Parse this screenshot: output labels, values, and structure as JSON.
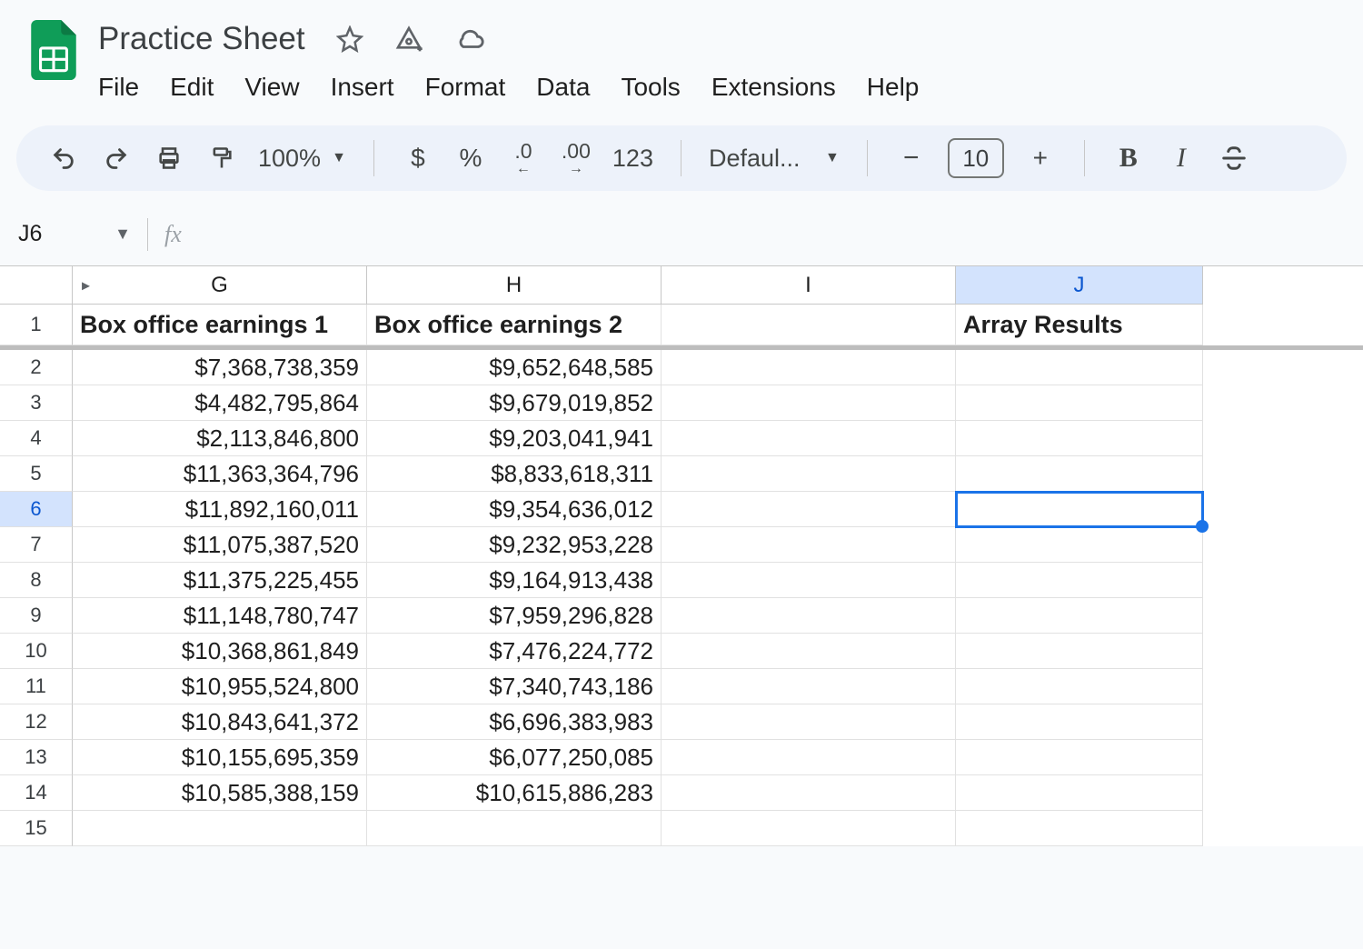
{
  "doc": {
    "title": "Practice Sheet"
  },
  "menu": {
    "file": "File",
    "edit": "Edit",
    "view": "View",
    "insert": "Insert",
    "format": "Format",
    "data": "Data",
    "tools": "Tools",
    "extensions": "Extensions",
    "help": "Help"
  },
  "toolbar": {
    "zoom": "100%",
    "currency": "$",
    "percent": "%",
    "decrease_decimal": ".0",
    "increase_decimal": ".00",
    "more_formats": "123",
    "font_name": "Defaul...",
    "font_size": "10",
    "minus": "−",
    "plus": "+",
    "bold": "B",
    "italic": "I"
  },
  "formula_bar": {
    "name_box": "J6",
    "fx_label": "fx"
  },
  "columns": {
    "G": "G",
    "H": "H",
    "I": "I",
    "J": "J"
  },
  "selected": {
    "row": 6,
    "col": "J"
  },
  "headers": {
    "G": "Box office earnings 1",
    "H": "Box office earnings 2",
    "I": "",
    "J": "Array Results"
  },
  "rows": [
    {
      "n": 2,
      "G": "$7,368,738,359",
      "H": "$9,652,648,585",
      "I": "",
      "J": ""
    },
    {
      "n": 3,
      "G": "$4,482,795,864",
      "H": "$9,679,019,852",
      "I": "",
      "J": ""
    },
    {
      "n": 4,
      "G": "$2,113,846,800",
      "H": "$9,203,041,941",
      "I": "",
      "J": ""
    },
    {
      "n": 5,
      "G": "$11,363,364,796",
      "H": "$8,833,618,311",
      "I": "",
      "J": ""
    },
    {
      "n": 6,
      "G": "$11,892,160,011",
      "H": "$9,354,636,012",
      "I": "",
      "J": ""
    },
    {
      "n": 7,
      "G": "$11,075,387,520",
      "H": "$9,232,953,228",
      "I": "",
      "J": ""
    },
    {
      "n": 8,
      "G": "$11,375,225,455",
      "H": "$9,164,913,438",
      "I": "",
      "J": ""
    },
    {
      "n": 9,
      "G": "$11,148,780,747",
      "H": "$7,959,296,828",
      "I": "",
      "J": ""
    },
    {
      "n": 10,
      "G": "$10,368,861,849",
      "H": "$7,476,224,772",
      "I": "",
      "J": ""
    },
    {
      "n": 11,
      "G": "$10,955,524,800",
      "H": "$7,340,743,186",
      "I": "",
      "J": ""
    },
    {
      "n": 12,
      "G": "$10,843,641,372",
      "H": "$6,696,383,983",
      "I": "",
      "J": ""
    },
    {
      "n": 13,
      "G": "$10,155,695,359",
      "H": "$6,077,250,085",
      "I": "",
      "J": ""
    },
    {
      "n": 14,
      "G": "$10,585,388,159",
      "H": "$10,615,886,283",
      "I": "",
      "J": ""
    },
    {
      "n": 15,
      "G": "",
      "H": "",
      "I": "",
      "J": ""
    }
  ]
}
